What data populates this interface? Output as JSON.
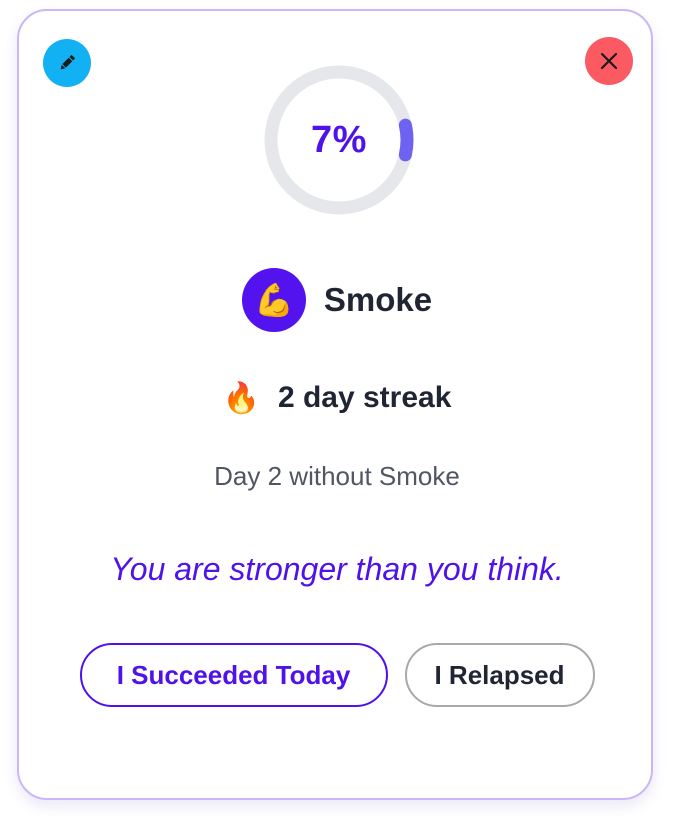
{
  "progress": {
    "label": "7%",
    "fraction": 0.07
  },
  "habit": {
    "name": "Smoke",
    "icon": "flexed-biceps-emoji"
  },
  "streak": {
    "icon": "fire-emoji",
    "text": "2 day streak"
  },
  "days_text": "Day 2 without Smoke",
  "motivation": "You are stronger than you think.",
  "actions": {
    "succeeded_label": "I Succeeded Today",
    "relapsed_label": "I Relapsed"
  },
  "colors": {
    "accent": "#4f12e9",
    "ring_track": "#e6e7eb",
    "ring_fill": "#6e62f0",
    "edit_button": "#12b1f3",
    "close_button": "#fb5a62",
    "card_border": "#c9b8f5"
  },
  "icons": {
    "edit": "pencil-icon",
    "close": "close-icon"
  }
}
